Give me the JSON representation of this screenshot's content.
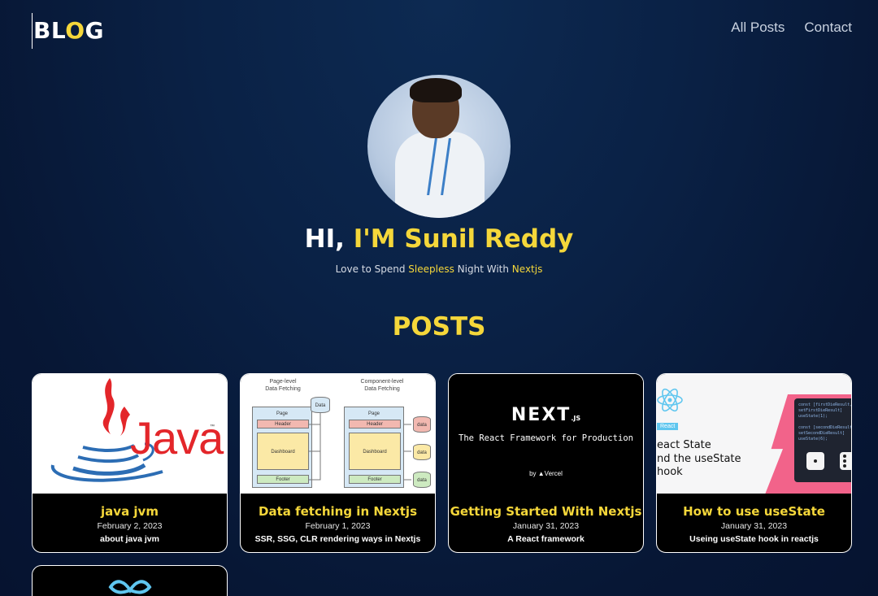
{
  "nav": {
    "logo_b": "B",
    "logo_l": "L",
    "logo_o": "O",
    "logo_g": "G",
    "links": [
      "All Posts",
      "Contact"
    ]
  },
  "hero": {
    "greeting_hi": "HI, ",
    "greeting_name": "I'M Sunil Reddy",
    "tagline_1": "Love to Spend ",
    "tagline_2": "Sleepless",
    "tagline_3": " Night With ",
    "tagline_4": "Nextjs"
  },
  "posts": {
    "heading": "POSTS",
    "items": [
      {
        "title": "java jvm",
        "date": "February 2, 2023",
        "desc": "about java jvm"
      },
      {
        "title": "Data fetching in Nextjs",
        "date": "February 1, 2023",
        "desc": "SSR, SSG, CLR rendering ways in Nextjs"
      },
      {
        "title": "Getting Started With Nextjs",
        "date": "January 31, 2023",
        "desc": "A React framework"
      },
      {
        "title": "How to use useState",
        "date": "January 31, 2023",
        "desc": "Useing useState hook in reactjs"
      }
    ]
  },
  "thumbs": {
    "java": {
      "word": "Java",
      "tm": "™"
    },
    "datafetch": {
      "page_level": "Page-level\nData Fetching",
      "component_level": "Component-level\nData Fetching",
      "data": "Data",
      "page": "Page",
      "header": "Header",
      "dashboard": "Dashboard",
      "footer": "Footer",
      "data_small": "data"
    },
    "next": {
      "logo": "NEXT",
      "logo_suffix": ".JS",
      "tagline": "The React Framework for Production",
      "by": "by ▲Vercel"
    },
    "usestate": {
      "badge": "React",
      "line1": "eact State",
      "line2": "nd the useState",
      "line3": "hook",
      "code": "const [firstDieResult,\nsetFirstDieResult]\nuseState(1);\n\nconst [secondDieResult,\nsetSecondDieResult]\nuseState(6);"
    }
  },
  "colors": {
    "accent": "#f5d73a",
    "java_red": "#e3262a",
    "java_blue": "#2c6db4",
    "react_blue": "#5fc6ef"
  }
}
